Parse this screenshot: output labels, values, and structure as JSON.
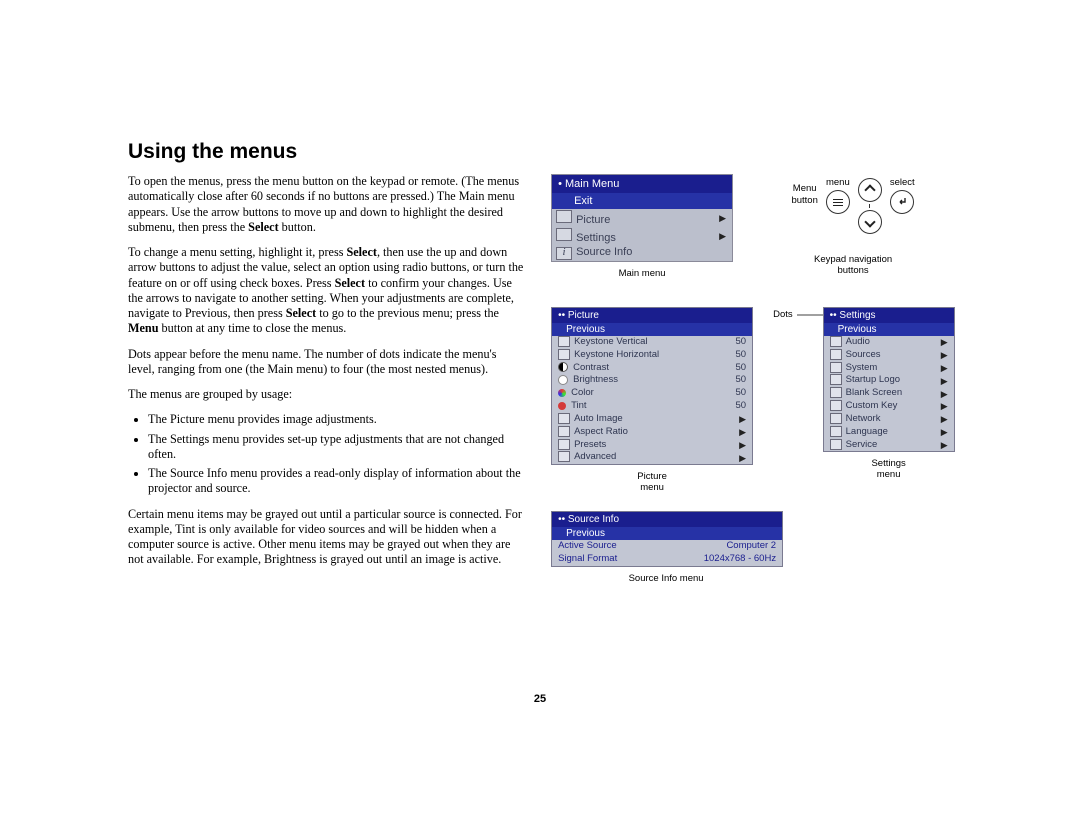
{
  "heading": "Using the menus",
  "body": {
    "p1": "To open the menus, press the menu button on the keypad or remote. (The menus automatically close after 60 seconds if no buttons are pressed.) The Main menu appears. Use the arrow buttons to move up and down to highlight the desired submenu, then press the ",
    "p1_bold": "Select",
    "p1_end": " button.",
    "p2a": "To change a menu setting, highlight it, press ",
    "p2a_bold": "Select",
    "p2b": ", then use the up and down arrow buttons to adjust the value, select an option using radio buttons, or turn the feature on or off using check boxes. Press ",
    "p2b_bold": "Select",
    "p2c": " to confirm your changes. Use the arrows to navigate to another setting. When your adjustments are complete, navigate to Previous, then press ",
    "p2c_bold": "Select",
    "p2d": " to go to the previous menu; press the ",
    "p2d_bold": "Menu",
    "p2e": " button at any time to close the menus.",
    "p3": "Dots appear before the menu name. The number of dots indicate the menu's level, ranging from one (the Main menu) to four (the most nested menus).",
    "p4": "The menus are grouped by usage:",
    "li1": "The Picture menu provides image adjustments.",
    "li2": "The Settings menu provides set-up type adjustments that are not changed often.",
    "li3": "The Source Info menu provides a read-only display of information about the projector and source.",
    "p5": "Certain menu items may be grayed out until a particular source is connected. For example, Tint is only available for video sources and will be hidden when a computer source is active. Other menu items may be grayed out when they are not available. For example, Brightness is grayed out until an image is active."
  },
  "main_menu": {
    "title": "• Main Menu",
    "selected": "Exit",
    "items": [
      "Picture",
      "Settings",
      "Source Info"
    ],
    "caption": "Main menu"
  },
  "keypad": {
    "left_lbl1": "Menu",
    "left_lbl2": "button",
    "mid": "menu",
    "right": "select",
    "caption1": "Keypad navigation",
    "caption2": "buttons"
  },
  "picture_menu": {
    "title": "•• Picture",
    "prev": "Previous",
    "rows": [
      {
        "name": "Keystone Vertical",
        "val": "50"
      },
      {
        "name": "Keystone Horizontal",
        "val": "50"
      },
      {
        "name": "Contrast",
        "val": "50"
      },
      {
        "name": "Brightness",
        "val": "50"
      },
      {
        "name": "Color",
        "val": "50"
      },
      {
        "name": "Tint",
        "val": "50"
      },
      {
        "name": "Auto Image",
        "val": "▶"
      },
      {
        "name": "Aspect Ratio",
        "val": "▶"
      },
      {
        "name": "Presets",
        "val": "▶"
      },
      {
        "name": "Advanced",
        "val": "▶"
      }
    ],
    "caption1": "Picture",
    "caption2": "menu"
  },
  "dots_label": "Dots",
  "settings_menu": {
    "title": "•• Settings",
    "prev": "Previous",
    "rows": [
      "Audio",
      "Sources",
      "System",
      "Startup Logo",
      "Blank Screen",
      "Custom Key",
      "Network",
      "Language",
      "Service"
    ],
    "caption1": "Settings",
    "caption2": "menu"
  },
  "source_info": {
    "title": "•• Source Info",
    "prev": "Previous",
    "rows": [
      {
        "k": "Active Source",
        "v": "Computer 2"
      },
      {
        "k": "Signal Format",
        "v": "1024x768 - 60Hz"
      }
    ],
    "caption": "Source Info menu"
  },
  "page_number": "25"
}
